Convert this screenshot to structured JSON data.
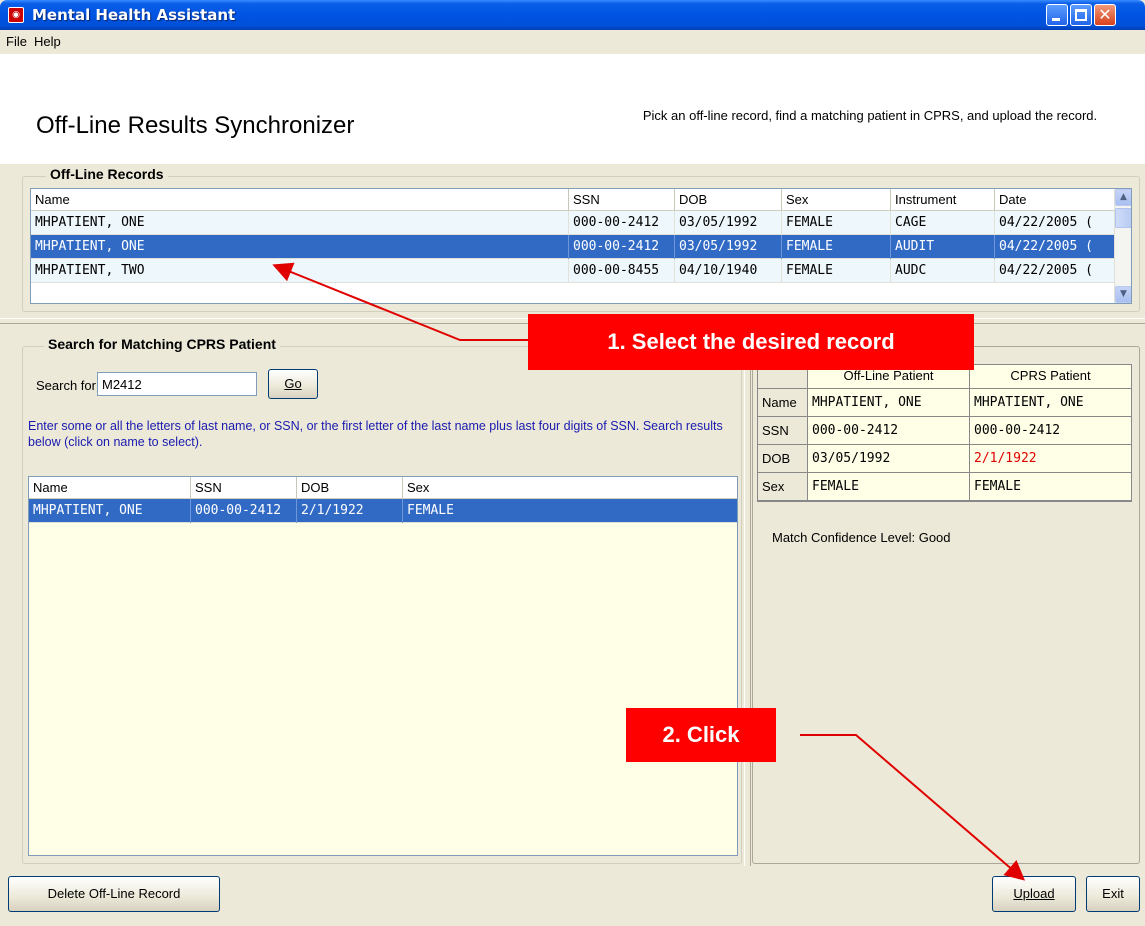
{
  "window": {
    "title": "Mental Health Assistant",
    "icon": "app-icon"
  },
  "menu": [
    "File",
    "Help"
  ],
  "header": {
    "title": "Off-Line Results Synchronizer",
    "instructions": "Pick an off-line record, find a matching patient in CPRS, and upload the record."
  },
  "offline_records": {
    "legend": "Off-Line Records",
    "columns": [
      "Name",
      "SSN",
      "DOB",
      "Sex",
      "Instrument",
      "Date"
    ],
    "rows": [
      {
        "name": "MHPATIENT, ONE",
        "ssn": "000-00-2412",
        "dob": "03/05/1992",
        "sex": "FEMALE",
        "instrument": "CAGE",
        "date": "04/22/2005 (",
        "selected": false
      },
      {
        "name": "MHPATIENT, ONE",
        "ssn": "000-00-2412",
        "dob": "03/05/1992",
        "sex": "FEMALE",
        "instrument": "AUDIT",
        "date": "04/22/2005 (",
        "selected": true
      },
      {
        "name": "MHPATIENT, TWO",
        "ssn": "000-00-8455",
        "dob": "04/10/1940",
        "sex": "FEMALE",
        "instrument": "AUDC",
        "date": "04/22/2005 (",
        "selected": false
      }
    ]
  },
  "search": {
    "legend": "Search for Matching CPRS Patient",
    "label": "Search for:",
    "value": "M2412",
    "go_label": "Go",
    "help": "Enter some or all the letters of last name, or SSN, or the first letter of the last name plus last four digits of SSN. Search results below (click on name to select).",
    "columns": [
      "Name",
      "SSN",
      "DOB",
      "Sex"
    ],
    "rows": [
      {
        "name": "MHPATIENT, ONE",
        "ssn": "000-00-2412",
        "dob": "2/1/1922",
        "sex": "FEMALE",
        "selected": true
      }
    ]
  },
  "comparison": {
    "headers": [
      "",
      "Off-Line Patient",
      "CPRS Patient"
    ],
    "rows": [
      {
        "label": "Name",
        "offline": "MHPATIENT, ONE",
        "cprs": "MHPATIENT, ONE",
        "mismatch": false
      },
      {
        "label": "SSN",
        "offline": "000-00-2412",
        "cprs": "000-00-2412",
        "mismatch": false
      },
      {
        "label": "DOB",
        "offline": "03/05/1992",
        "cprs": "2/1/1922",
        "mismatch": true
      },
      {
        "label": "Sex",
        "offline": "FEMALE",
        "cprs": "FEMALE",
        "mismatch": false
      }
    ],
    "match_label": "Match Confidence Level:",
    "match_value": "Good"
  },
  "buttons": {
    "delete": "Delete Off-Line Record",
    "upload": "Upload",
    "exit": "Exit"
  },
  "callouts": {
    "step1": "1. Select the desired record",
    "step2": "2. Click"
  },
  "colors": {
    "selection": "#316ac5",
    "callout": "#ff0000",
    "mismatch": "#e00000",
    "titlebar": "#0054e3"
  }
}
